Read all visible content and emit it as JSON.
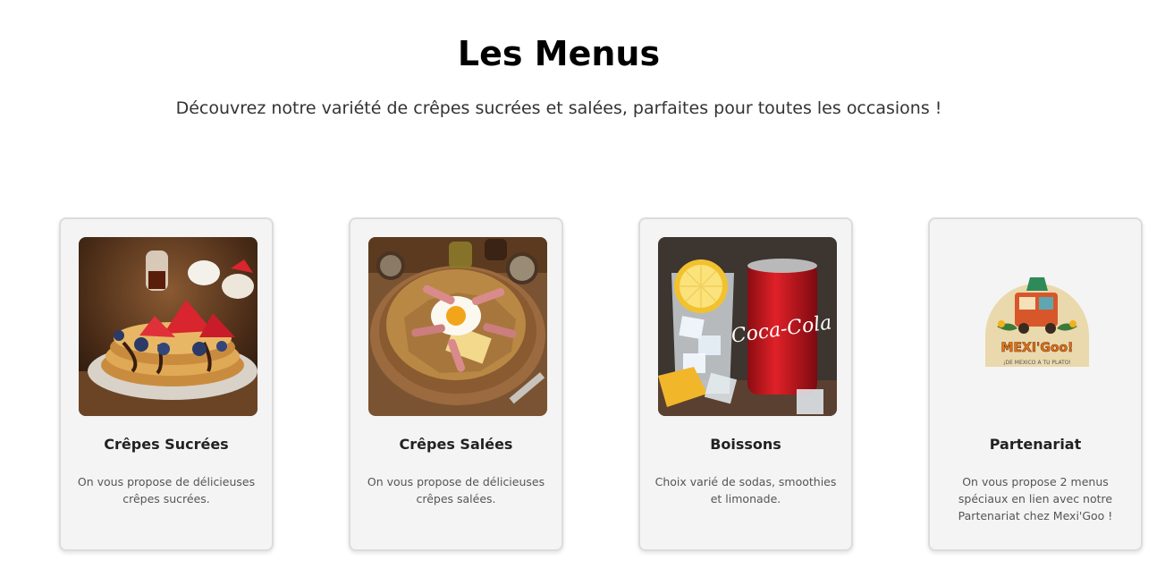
{
  "header": {
    "title": "Les Menus",
    "subtitle": "Découvrez notre variété de crêpes sucrées et salées, parfaites pour toutes les occasions !"
  },
  "cards": [
    {
      "title": "Crêpes Sucrées",
      "description": "On vous propose de délicieuses crêpes sucrées.",
      "image": "sweet-crepes-strawberries-photo"
    },
    {
      "title": "Crêpes Salées",
      "description": "On vous propose de délicieuses crêpes salées.",
      "image": "savory-crepe-ham-egg-photo"
    },
    {
      "title": "Boissons",
      "description": "Choix varié de sodas, smoothies et limonade.",
      "image": "cola-can-lemon-soda-photo"
    },
    {
      "title": "Partenariat",
      "description": "On vous propose 2 menus spéciaux en lien avec notre Partenariat chez Mexi'Goo !",
      "image": "mexigoo-logo",
      "logo_text": "MEXI'Goo!",
      "logo_tagline": "¡DE MEXICO A TU PLATO!"
    }
  ]
}
